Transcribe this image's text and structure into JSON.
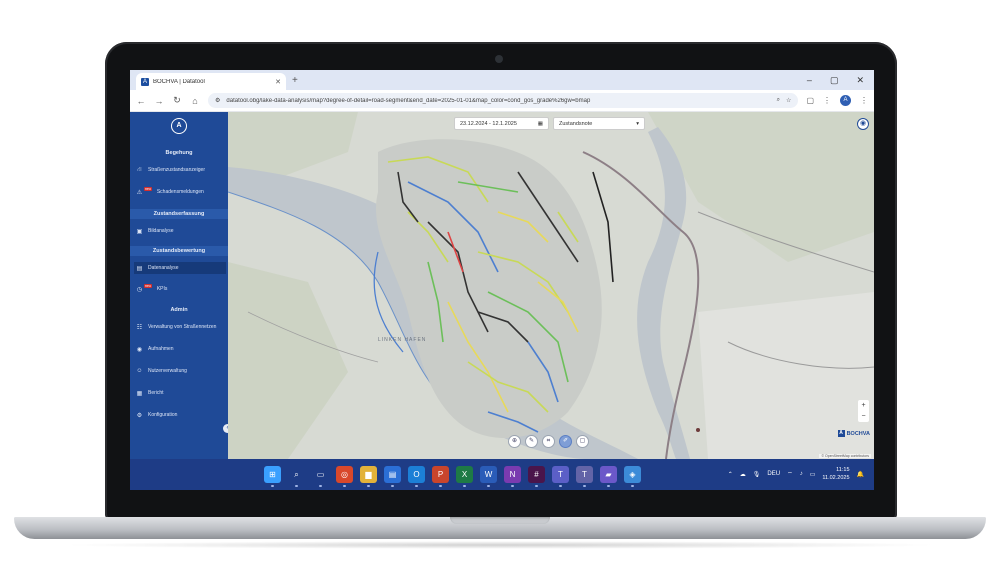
{
  "browser": {
    "tab_title": "BOCHVA | Datatool",
    "tab_favicon": "A",
    "new_tab": "+",
    "window_controls": [
      "–",
      "▢",
      "✕"
    ],
    "url": "datatool.obg/lake-data-analysis/map?degree-of-detail=road-segment&end_date=2025-01-01&map_color=cond_gos_grade%26gw=bmap",
    "profile_initial": "A"
  },
  "sidebar": {
    "logo": "A",
    "sections": [
      {
        "title": "Begehung",
        "items": [
          {
            "label": "Straßenzustandsanzeiger",
            "icon": "road-icon",
            "glyph": "⛙",
            "badge": ""
          },
          {
            "label": "Schadensmeldungen",
            "icon": "alert-icon",
            "glyph": "⚠",
            "badge": "neu"
          }
        ]
      },
      {
        "title": "Zustandserfassung",
        "items": [
          {
            "label": "Bildanalyse",
            "icon": "image-icon",
            "glyph": "▣",
            "badge": ""
          }
        ]
      },
      {
        "title": "Zustandsbewertung",
        "items": [
          {
            "label": "Datenanalyse",
            "icon": "chart-icon",
            "glyph": "▤",
            "badge": ""
          },
          {
            "label": "KPIs",
            "icon": "kpi-icon",
            "glyph": "◷",
            "badge": "neu"
          }
        ]
      },
      {
        "title": "Admin",
        "items": [
          {
            "label": "Verwaltung von Straßennetzen",
            "icon": "network-icon",
            "glyph": "☷",
            "badge": ""
          },
          {
            "label": "Aufnahmen",
            "icon": "camera-icon",
            "glyph": "◉",
            "badge": ""
          },
          {
            "label": "Nutzerverwaltung",
            "icon": "users-icon",
            "glyph": "☺",
            "badge": ""
          },
          {
            "label": "Bericht",
            "icon": "report-icon",
            "glyph": "▦",
            "badge": ""
          },
          {
            "label": "Konfiguration",
            "icon": "settings-icon",
            "glyph": "⚙",
            "badge": ""
          }
        ]
      }
    ]
  },
  "map": {
    "date_range": "23.12.2024 - 12.1.2025",
    "layer": "Zustandsnote",
    "place_label": "LINKEN HAFEN",
    "logo_text": "BOCHVA",
    "attribution": "© OpenStreetMap contributors",
    "tools": [
      "⊕",
      "✎",
      "⌗",
      "✐",
      "▢"
    ]
  },
  "taskbar": {
    "apps": [
      {
        "name": "windows-start-icon",
        "glyph": "⊞",
        "color": "#3aa0ff"
      },
      {
        "name": "search-icon",
        "glyph": "⌕",
        "color": "transparent"
      },
      {
        "name": "task-view-icon",
        "glyph": "▭",
        "color": "transparent"
      },
      {
        "name": "chrome-icon",
        "glyph": "◎",
        "color": "#d9482b"
      },
      {
        "name": "file-explorer-icon",
        "glyph": "▆",
        "color": "#e2b23a"
      },
      {
        "name": "store-icon",
        "glyph": "▤",
        "color": "#2b6fd6"
      },
      {
        "name": "outlook-icon",
        "glyph": "O",
        "color": "#1c7fd6"
      },
      {
        "name": "powerpoint-icon",
        "glyph": "P",
        "color": "#c9452c"
      },
      {
        "name": "excel-icon",
        "glyph": "X",
        "color": "#1e7a45"
      },
      {
        "name": "word-icon",
        "glyph": "W",
        "color": "#2a5cb8"
      },
      {
        "name": "onenote-icon",
        "glyph": "N",
        "color": "#7a3bb0"
      },
      {
        "name": "slack-icon",
        "glyph": "#",
        "color": "#4a154b"
      },
      {
        "name": "teams-icon",
        "glyph": "T",
        "color": "#5b5fc7"
      },
      {
        "name": "teams-chat-icon",
        "glyph": "T",
        "color": "#6264a7"
      },
      {
        "name": "notes-icon",
        "glyph": "▰",
        "color": "#6b58c9"
      },
      {
        "name": "photos-icon",
        "glyph": "◈",
        "color": "#3c8bd8"
      }
    ],
    "tray_lang": "DEU",
    "time": "11:15",
    "date": "11.02.2025"
  }
}
